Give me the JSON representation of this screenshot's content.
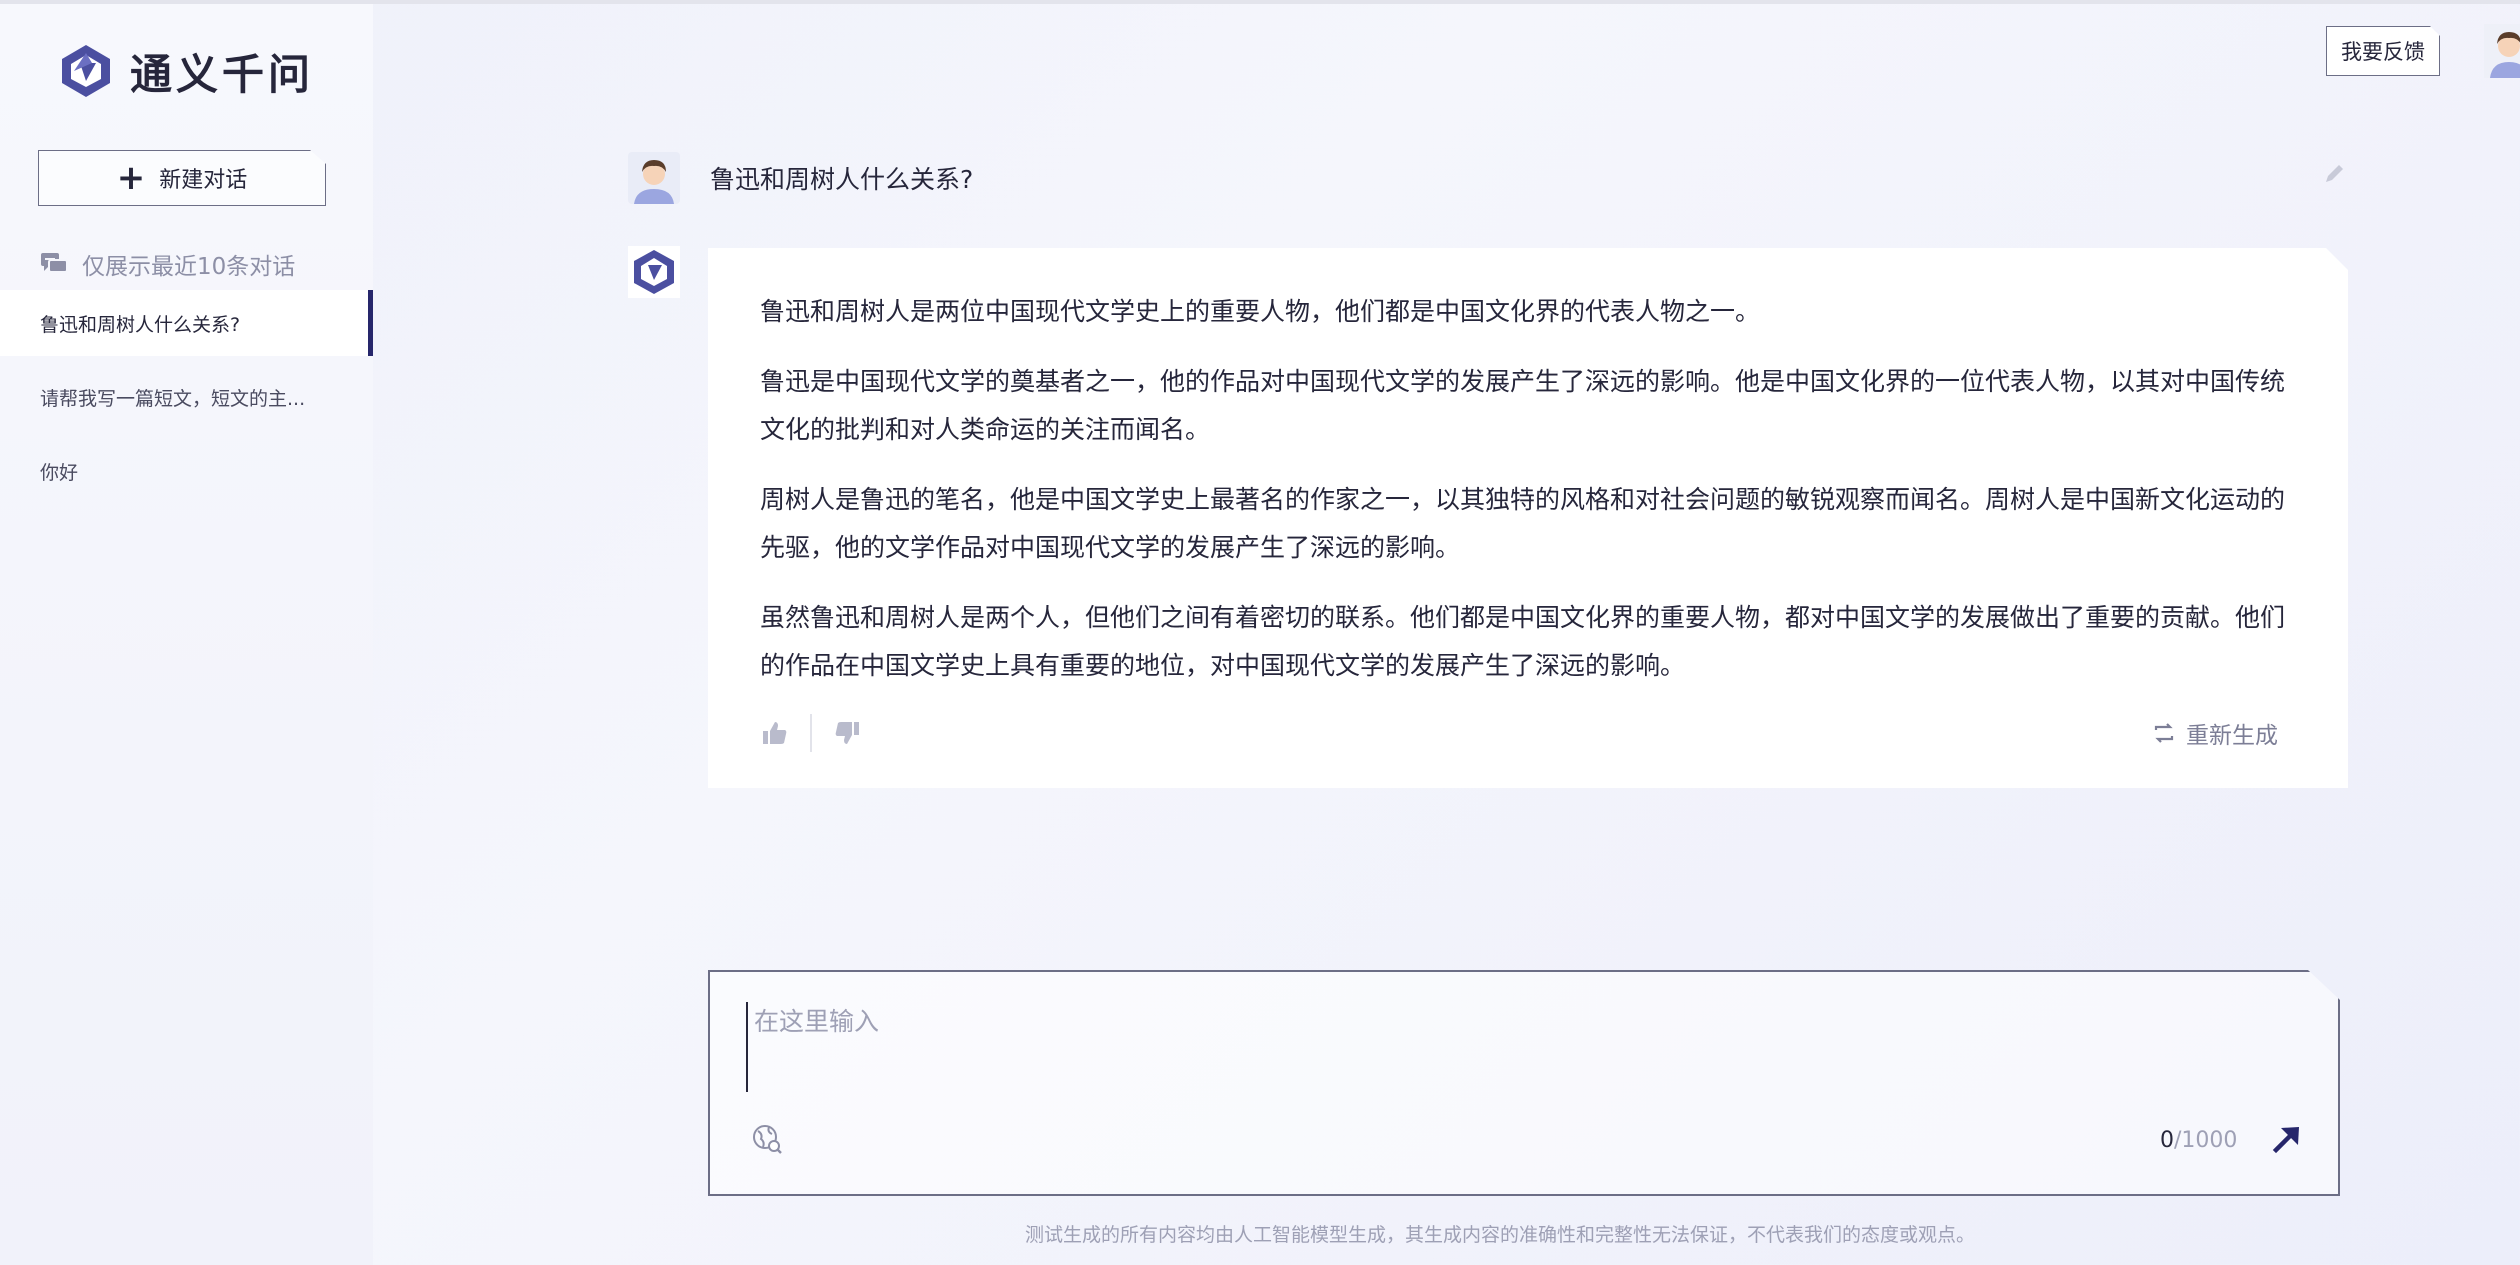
{
  "app": {
    "name": "通义千问"
  },
  "sidebar": {
    "new_chat_label": "新建对话",
    "recent_hint": "仅展示最近10条对话",
    "conversations": [
      {
        "title": "鲁迅和周树人什么关系?"
      },
      {
        "title": "请帮我写一篇短文，短文的主..."
      },
      {
        "title": "你好"
      }
    ]
  },
  "header": {
    "feedback_label": "我要反馈"
  },
  "chat": {
    "user_question": "鲁迅和周树人什么关系?",
    "answer_paragraphs": [
      "鲁迅和周树人是两位中国现代文学史上的重要人物，他们都是中国文化界的代表人物之一。",
      "鲁迅是中国现代文学的奠基者之一，他的作品对中国现代文学的发展产生了深远的影响。他是中国文化界的一位代表人物，以其对中国传统文化的批判和对人类命运的关注而闻名。",
      "周树人是鲁迅的笔名，他是中国文学史上最著名的作家之一，以其独特的风格和对社会问题的敏锐观察而闻名。周树人是中国新文化运动的先驱，他的文学作品对中国现代文学的发展产生了深远的影响。",
      "虽然鲁迅和周树人是两个人，但他们之间有着密切的联系。他们都是中国文化界的重要人物，都对中国文学的发展做出了重要的贡献。他们的作品在中国文学史上具有重要的地位，对中国现代文学的发展产生了深远的影响。"
    ],
    "regenerate_label": "重新生成"
  },
  "input": {
    "placeholder": "在这里输入",
    "char_count": "0",
    "char_limit": "/1000"
  },
  "footer": {
    "disclaimer": "测试生成的所有内容均由人工智能模型生成，其生成内容的准确性和完整性无法保证，不代表我们的态度或观点。"
  },
  "icons": {
    "logo": "tongyi-logo-icon",
    "new_chat": "plus-icon",
    "recent": "chat-bubbles-icon",
    "edit": "pencil-icon",
    "like": "thumbs-up-icon",
    "dislike": "thumbs-down-icon",
    "regenerate": "refresh-icon",
    "plugin": "globe-search-icon",
    "send": "send-arrow-icon"
  },
  "colors": {
    "accent": "#26266b",
    "text": "#26263b",
    "muted": "#9ea0b5"
  }
}
